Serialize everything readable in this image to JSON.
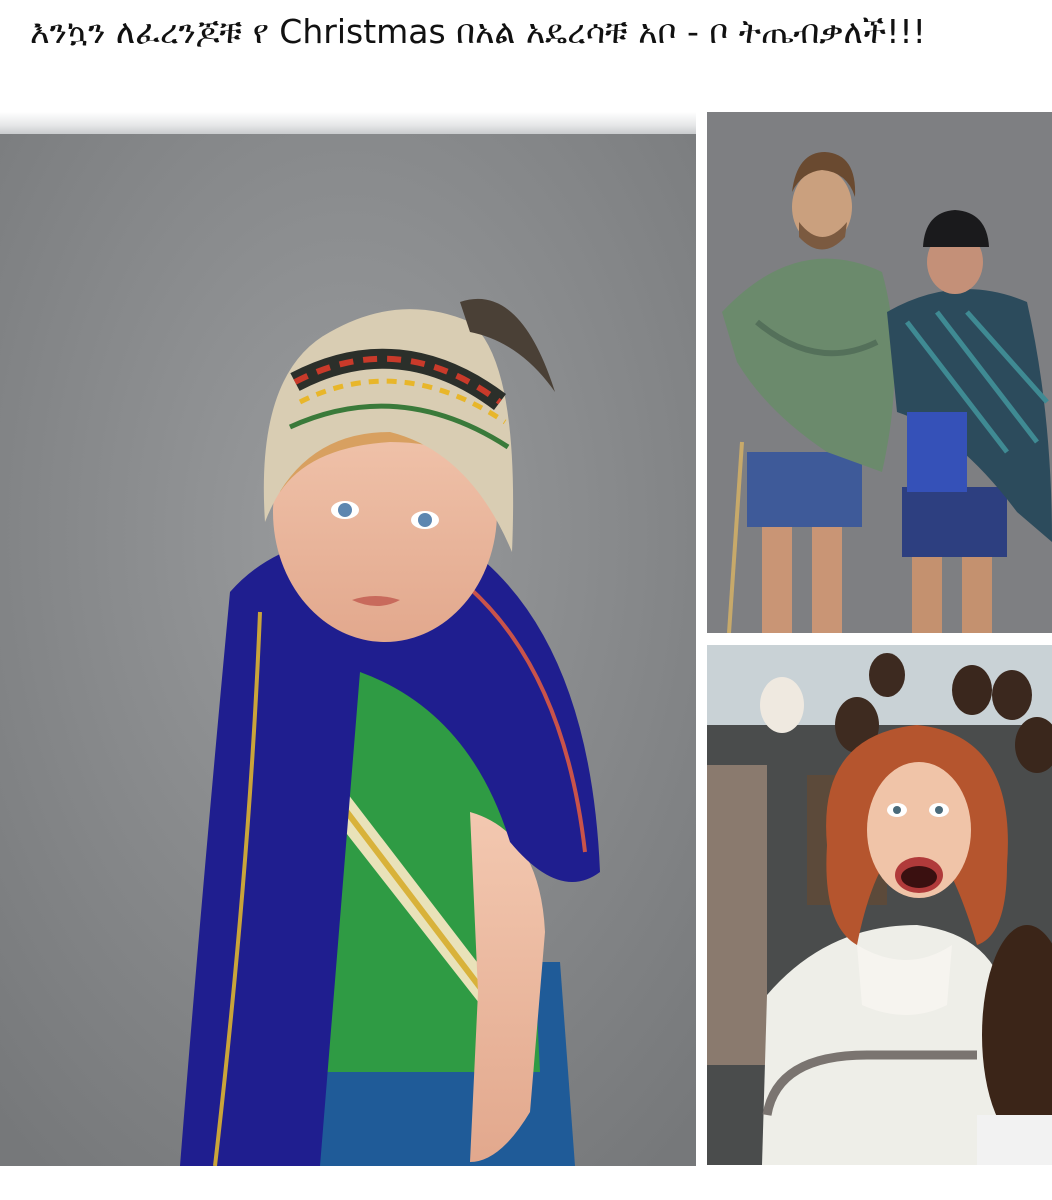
{
  "post": {
    "caption": "እንኳን ለፈረንጆቹ የ Christmas በአል አዴረሳቹ አቦ - ቦ ትጤብቃለች!!!"
  },
  "images": [
    {
      "name": "boy-in-ethiopian-hat-and-scarf-photo"
    },
    {
      "name": "two-men-in-shawls-photo"
    },
    {
      "name": "screaming-woman-on-bus-photo"
    }
  ]
}
